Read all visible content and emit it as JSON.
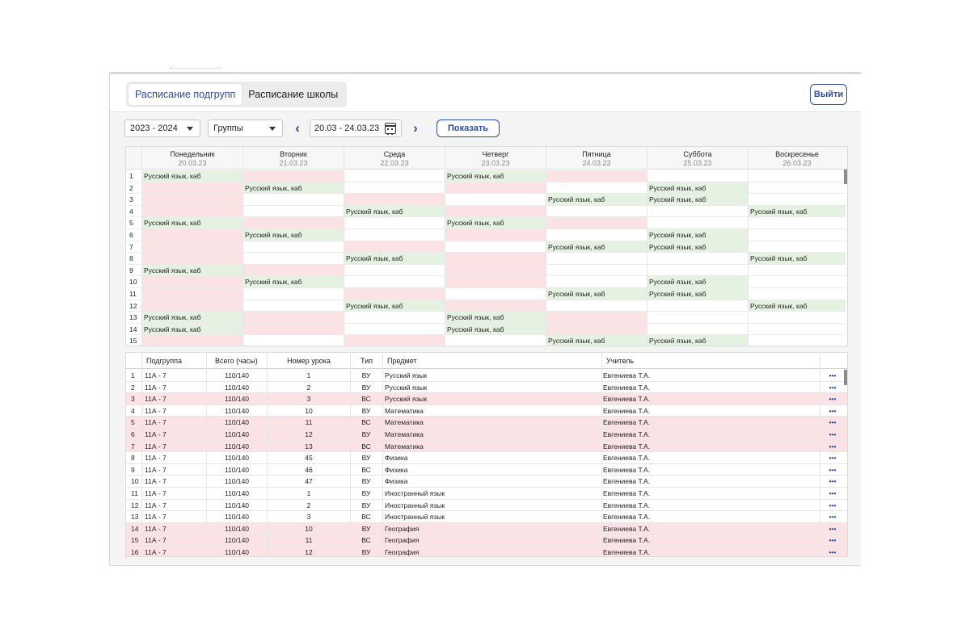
{
  "tabs": [
    {
      "label": "Расписание подгрупп",
      "active": true
    },
    {
      "label": "Расписание школы",
      "active": false
    }
  ],
  "logout_label": "Выйти",
  "filters": {
    "year": "2023  - 2024",
    "group": "Группы",
    "date_range": "20.03 - 24.03.23",
    "show_label": "Показать",
    "prev_icon": "chevron-left-icon",
    "next_icon": "chevron-right-icon"
  },
  "colors": {
    "accent": "#2d4d9e",
    "green": "#e5f2e1",
    "red": "#fbe3e5"
  },
  "week": {
    "days": [
      {
        "name": "Понедельник",
        "date": "20.03.23"
      },
      {
        "name": "Вторник",
        "date": "21.03.23"
      },
      {
        "name": "Среда",
        "date": "22.03.23"
      },
      {
        "name": "Четверг",
        "date": "23.03.23"
      },
      {
        "name": "Пятница",
        "date": "24.03.23"
      },
      {
        "name": "Суббота",
        "date": "25.03.23"
      },
      {
        "name": "Воскресенье",
        "date": "26.03.23"
      }
    ],
    "lesson_text": "Русский язык, каб",
    "rows": [
      {
        "n": "1",
        "cells": [
          "g",
          "r",
          "w",
          "g",
          "r",
          "w",
          "w"
        ]
      },
      {
        "n": "2",
        "cells": [
          "r",
          "g",
          "w",
          "r",
          "w",
          "g",
          "w"
        ]
      },
      {
        "n": "3",
        "cells": [
          "r",
          "w",
          "r",
          "w",
          "g",
          "g",
          "w"
        ]
      },
      {
        "n": "4",
        "cells": [
          "r",
          "w",
          "g",
          "r",
          "w",
          "w",
          "g"
        ]
      },
      {
        "n": "5",
        "cells": [
          "g",
          "r",
          "w",
          "g",
          "r",
          "w",
          "w"
        ]
      },
      {
        "n": "6",
        "cells": [
          "r",
          "g",
          "w",
          "r",
          "w",
          "g",
          "w"
        ]
      },
      {
        "n": "7",
        "cells": [
          "r",
          "w",
          "r",
          "w",
          "g",
          "g",
          "w"
        ]
      },
      {
        "n": "8",
        "cells": [
          "r",
          "w",
          "g",
          "r",
          "w",
          "w",
          "g"
        ]
      },
      {
        "n": "9",
        "cells": [
          "g",
          "r",
          "w",
          "r",
          "w",
          "w",
          "w"
        ]
      },
      {
        "n": "10",
        "cells": [
          "r",
          "g",
          "w",
          "r",
          "w",
          "g",
          "w"
        ]
      },
      {
        "n": "11",
        "cells": [
          "r",
          "w",
          "r",
          "w",
          "g",
          "g",
          "w"
        ]
      },
      {
        "n": "12",
        "cells": [
          "r",
          "w",
          "g",
          "r",
          "w",
          "w",
          "g"
        ]
      },
      {
        "n": "13",
        "cells": [
          "g",
          "r",
          "w",
          "g",
          "r",
          "w",
          "w"
        ]
      },
      {
        "n": "14",
        "cells": [
          "g",
          "r",
          "w",
          "g",
          "r",
          "w",
          "w"
        ]
      },
      {
        "n": "15",
        "cells": [
          "r",
          "w",
          "r",
          "w",
          "g",
          "g",
          "w"
        ]
      }
    ]
  },
  "lessons": {
    "headers": {
      "group": "Подгруппа",
      "total": "Всего (часы)",
      "lesson": "Номер урока",
      "type": "Тип",
      "subject": "Предмет",
      "teacher": "Учитель"
    },
    "menu_icon": "more-horizontal-icon",
    "rows": [
      {
        "n": "1",
        "group": "11А - 7",
        "total": "110/140",
        "lesson": "1",
        "type": "ВУ",
        "subject": "Русский язык",
        "teacher": "Евгениева Т.А.",
        "hl": false
      },
      {
        "n": "2",
        "group": "11А - 7",
        "total": "110/140",
        "lesson": "2",
        "type": "ВУ",
        "subject": "Русский язык",
        "teacher": "Евгениева Т.А.",
        "hl": false
      },
      {
        "n": "3",
        "group": "11А - 7",
        "total": "110/140",
        "lesson": "3",
        "type": "ВС",
        "subject": "Русский язык",
        "teacher": "Евгениева Т.А.",
        "hl": true
      },
      {
        "n": "4",
        "group": "11А - 7",
        "total": "110/140",
        "lesson": "10",
        "type": "ВУ",
        "subject": "Математика",
        "teacher": "Евгениева Т.А.",
        "hl": false
      },
      {
        "n": "5",
        "group": "11А - 7",
        "total": "110/140",
        "lesson": "11",
        "type": "ВС",
        "subject": "Математика",
        "teacher": "Евгениева Т.А.",
        "hl": true
      },
      {
        "n": "6",
        "group": "11А - 7",
        "total": "110/140",
        "lesson": "12",
        "type": "ВУ",
        "subject": "Математика",
        "teacher": "Евгениева Т.А.",
        "hl": true
      },
      {
        "n": "7",
        "group": "11А - 7",
        "total": "110/140",
        "lesson": "13",
        "type": "ВС",
        "subject": "Математика",
        "teacher": "Евгениева Т.А.",
        "hl": true
      },
      {
        "n": "8",
        "group": "11А - 7",
        "total": "110/140",
        "lesson": "45",
        "type": "ВУ",
        "subject": "Физика",
        "teacher": "Евгениева Т.А.",
        "hl": false
      },
      {
        "n": "9",
        "group": "11А - 7",
        "total": "110/140",
        "lesson": "46",
        "type": "ВС",
        "subject": "Физика",
        "teacher": "Евгениева Т.А.",
        "hl": false
      },
      {
        "n": "10",
        "group": "11А - 7",
        "total": "110/140",
        "lesson": "47",
        "type": "ВУ",
        "subject": "Физика",
        "teacher": "Евгениева Т.А.",
        "hl": false
      },
      {
        "n": "11",
        "group": "11А - 7",
        "total": "110/140",
        "lesson": "1",
        "type": "ВУ",
        "subject": "Иностранный язык",
        "teacher": "Евгениева Т.А.",
        "hl": false
      },
      {
        "n": "12",
        "group": "11А - 7",
        "total": "110/140",
        "lesson": "2",
        "type": "ВУ",
        "subject": "Иностранный язык",
        "teacher": "Евгениева Т.А.",
        "hl": false
      },
      {
        "n": "13",
        "group": "11А - 7",
        "total": "110/140",
        "lesson": "3",
        "type": "ВС",
        "subject": "Иностранный язык",
        "teacher": "Евгениева Т.А.",
        "hl": false
      },
      {
        "n": "14",
        "group": "11А - 7",
        "total": "110/140",
        "lesson": "10",
        "type": "ВУ",
        "subject": "География",
        "teacher": "Евгениева Т.А.",
        "hl": true
      },
      {
        "n": "15",
        "group": "11А - 7",
        "total": "110/140",
        "lesson": "11",
        "type": "ВС",
        "subject": "География",
        "teacher": "Евгениева Т.А.",
        "hl": true
      },
      {
        "n": "16",
        "group": "11А - 7",
        "total": "110/140",
        "lesson": "12",
        "type": "ВУ",
        "subject": "География",
        "teacher": "Евгениева Т.А.",
        "hl": true
      }
    ]
  }
}
